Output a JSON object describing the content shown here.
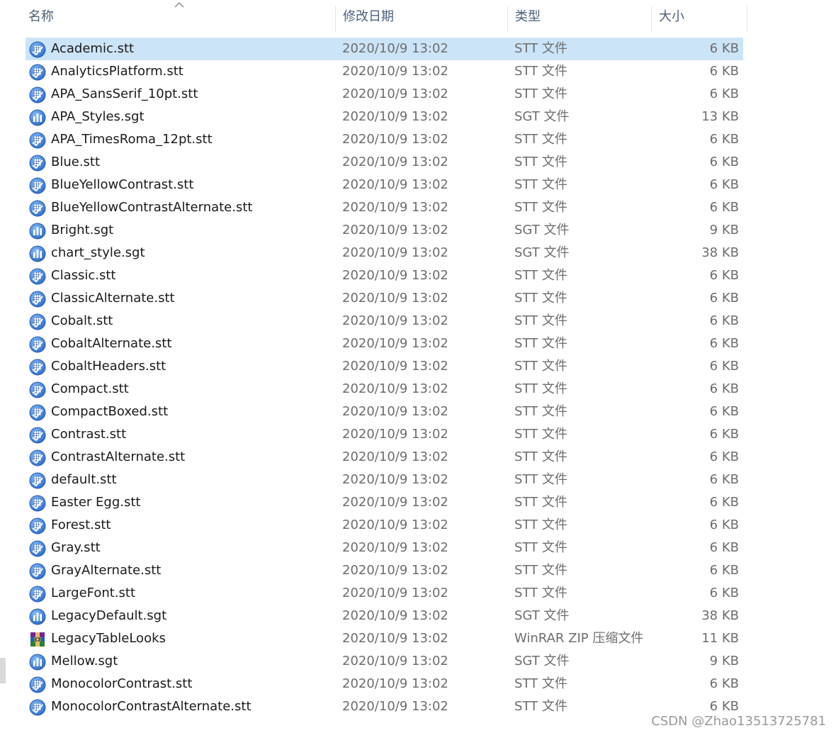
{
  "columns": {
    "name": "名称",
    "date": "修改日期",
    "type": "类型",
    "size": "大小"
  },
  "sort_indicator": "chevron-up-icon",
  "icons": {
    "stt": "table-look-icon",
    "sgt": "chart-template-icon",
    "zip": "winrar-archive-icon"
  },
  "colors": {
    "selection": "#cce4f7",
    "header_text": "#4c607a",
    "stt_icon": "#3a7bd5",
    "sgt_icon": "#2e6cc7"
  },
  "files": [
    {
      "name": "Academic.stt",
      "date": "2020/10/9 13:02",
      "type": "STT 文件",
      "size": "6 KB",
      "icon": "stt",
      "selected": true
    },
    {
      "name": "AnalyticsPlatform.stt",
      "date": "2020/10/9 13:02",
      "type": "STT 文件",
      "size": "6 KB",
      "icon": "stt"
    },
    {
      "name": "APA_SansSerif_10pt.stt",
      "date": "2020/10/9 13:02",
      "type": "STT 文件",
      "size": "6 KB",
      "icon": "stt"
    },
    {
      "name": "APA_Styles.sgt",
      "date": "2020/10/9 13:02",
      "type": "SGT 文件",
      "size": "13 KB",
      "icon": "sgt"
    },
    {
      "name": "APA_TimesRoma_12pt.stt",
      "date": "2020/10/9 13:02",
      "type": "STT 文件",
      "size": "6 KB",
      "icon": "stt"
    },
    {
      "name": "Blue.stt",
      "date": "2020/10/9 13:02",
      "type": "STT 文件",
      "size": "6 KB",
      "icon": "stt"
    },
    {
      "name": "BlueYellowContrast.stt",
      "date": "2020/10/9 13:02",
      "type": "STT 文件",
      "size": "6 KB",
      "icon": "stt"
    },
    {
      "name": "BlueYellowContrastAlternate.stt",
      "date": "2020/10/9 13:02",
      "type": "STT 文件",
      "size": "6 KB",
      "icon": "stt"
    },
    {
      "name": "Bright.sgt",
      "date": "2020/10/9 13:02",
      "type": "SGT 文件",
      "size": "9 KB",
      "icon": "sgt"
    },
    {
      "name": "chart_style.sgt",
      "date": "2020/10/9 13:02",
      "type": "SGT 文件",
      "size": "38 KB",
      "icon": "sgt"
    },
    {
      "name": "Classic.stt",
      "date": "2020/10/9 13:02",
      "type": "STT 文件",
      "size": "6 KB",
      "icon": "stt"
    },
    {
      "name": "ClassicAlternate.stt",
      "date": "2020/10/9 13:02",
      "type": "STT 文件",
      "size": "6 KB",
      "icon": "stt"
    },
    {
      "name": "Cobalt.stt",
      "date": "2020/10/9 13:02",
      "type": "STT 文件",
      "size": "6 KB",
      "icon": "stt"
    },
    {
      "name": "CobaltAlternate.stt",
      "date": "2020/10/9 13:02",
      "type": "STT 文件",
      "size": "6 KB",
      "icon": "stt"
    },
    {
      "name": "CobaltHeaders.stt",
      "date": "2020/10/9 13:02",
      "type": "STT 文件",
      "size": "6 KB",
      "icon": "stt"
    },
    {
      "name": "Compact.stt",
      "date": "2020/10/9 13:02",
      "type": "STT 文件",
      "size": "6 KB",
      "icon": "stt"
    },
    {
      "name": "CompactBoxed.stt",
      "date": "2020/10/9 13:02",
      "type": "STT 文件",
      "size": "6 KB",
      "icon": "stt"
    },
    {
      "name": "Contrast.stt",
      "date": "2020/10/9 13:02",
      "type": "STT 文件",
      "size": "6 KB",
      "icon": "stt"
    },
    {
      "name": "ContrastAlternate.stt",
      "date": "2020/10/9 13:02",
      "type": "STT 文件",
      "size": "6 KB",
      "icon": "stt"
    },
    {
      "name": "default.stt",
      "date": "2020/10/9 13:02",
      "type": "STT 文件",
      "size": "6 KB",
      "icon": "stt"
    },
    {
      "name": "Easter Egg.stt",
      "date": "2020/10/9 13:02",
      "type": "STT 文件",
      "size": "6 KB",
      "icon": "stt"
    },
    {
      "name": "Forest.stt",
      "date": "2020/10/9 13:02",
      "type": "STT 文件",
      "size": "6 KB",
      "icon": "stt"
    },
    {
      "name": "Gray.stt",
      "date": "2020/10/9 13:02",
      "type": "STT 文件",
      "size": "6 KB",
      "icon": "stt"
    },
    {
      "name": "GrayAlternate.stt",
      "date": "2020/10/9 13:02",
      "type": "STT 文件",
      "size": "6 KB",
      "icon": "stt"
    },
    {
      "name": "LargeFont.stt",
      "date": "2020/10/9 13:02",
      "type": "STT 文件",
      "size": "6 KB",
      "icon": "stt"
    },
    {
      "name": "LegacyDefault.sgt",
      "date": "2020/10/9 13:02",
      "type": "SGT 文件",
      "size": "38 KB",
      "icon": "sgt"
    },
    {
      "name": "LegacyTableLooks",
      "date": "2020/10/9 13:02",
      "type": "WinRAR ZIP 压缩文件",
      "size": "11 KB",
      "icon": "zip"
    },
    {
      "name": "Mellow.sgt",
      "date": "2020/10/9 13:02",
      "type": "SGT 文件",
      "size": "9 KB",
      "icon": "sgt"
    },
    {
      "name": "MonocolorContrast.stt",
      "date": "2020/10/9 13:02",
      "type": "STT 文件",
      "size": "6 KB",
      "icon": "stt"
    },
    {
      "name": "MonocolorContrastAlternate.stt",
      "date": "2020/10/9 13:02",
      "type": "STT 文件",
      "size": "6 KB",
      "icon": "stt"
    }
  ],
  "watermark": "CSDN @Zhao13513725781"
}
